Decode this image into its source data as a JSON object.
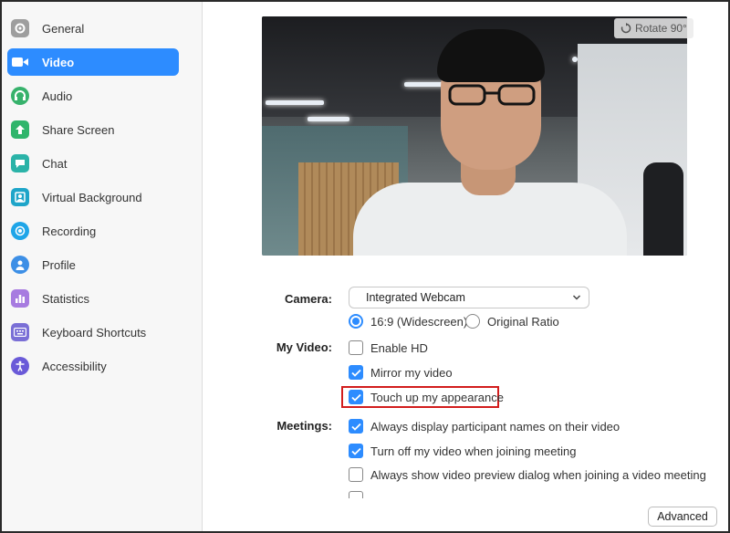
{
  "sidebar": {
    "items": [
      {
        "label": "General",
        "icon": "gear-icon",
        "color": "#9e9e9e"
      },
      {
        "label": "Video",
        "icon": "video-camera-icon",
        "color": "#ffffff",
        "active": true
      },
      {
        "label": "Audio",
        "icon": "headphones-icon",
        "color": "#37b26c"
      },
      {
        "label": "Share Screen",
        "icon": "share-screen-icon",
        "color": "#2fb56b"
      },
      {
        "label": "Chat",
        "icon": "chat-icon",
        "color": "#2bb3a8"
      },
      {
        "label": "Virtual Background",
        "icon": "virtual-background-icon",
        "color": "#1ea5c9"
      },
      {
        "label": "Recording",
        "icon": "recording-icon",
        "color": "#1ea5e8"
      },
      {
        "label": "Profile",
        "icon": "profile-icon",
        "color": "#3d8fe6"
      },
      {
        "label": "Statistics",
        "icon": "statistics-icon",
        "color": "#a77be0"
      },
      {
        "label": "Keyboard Shortcuts",
        "icon": "keyboard-icon",
        "color": "#7a6fd6"
      },
      {
        "label": "Accessibility",
        "icon": "accessibility-icon",
        "color": "#6a5ad8"
      }
    ]
  },
  "preview": {
    "rotate_label": "Rotate 90°"
  },
  "camera": {
    "label": "Camera:",
    "selected": "Integrated Webcam",
    "ratio_options": [
      {
        "label": "16:9 (Widescreen)",
        "selected": true
      },
      {
        "label": "Original Ratio",
        "selected": false
      }
    ]
  },
  "my_video": {
    "label": "My Video:",
    "options": [
      {
        "label": "Enable HD",
        "checked": false
      },
      {
        "label": "Mirror my video",
        "checked": true
      },
      {
        "label": "Touch up my appearance",
        "checked": true
      }
    ]
  },
  "meetings": {
    "label": "Meetings:",
    "options": [
      {
        "label": "Always display participant names on their video",
        "checked": true
      },
      {
        "label": "Turn off my video when joining meeting",
        "checked": true
      },
      {
        "label": "Always show video preview dialog when joining a video meeting",
        "checked": false
      }
    ]
  },
  "advanced_label": "Advanced",
  "colors": {
    "accent": "#2d8cff",
    "highlight": "#d21d1d"
  }
}
